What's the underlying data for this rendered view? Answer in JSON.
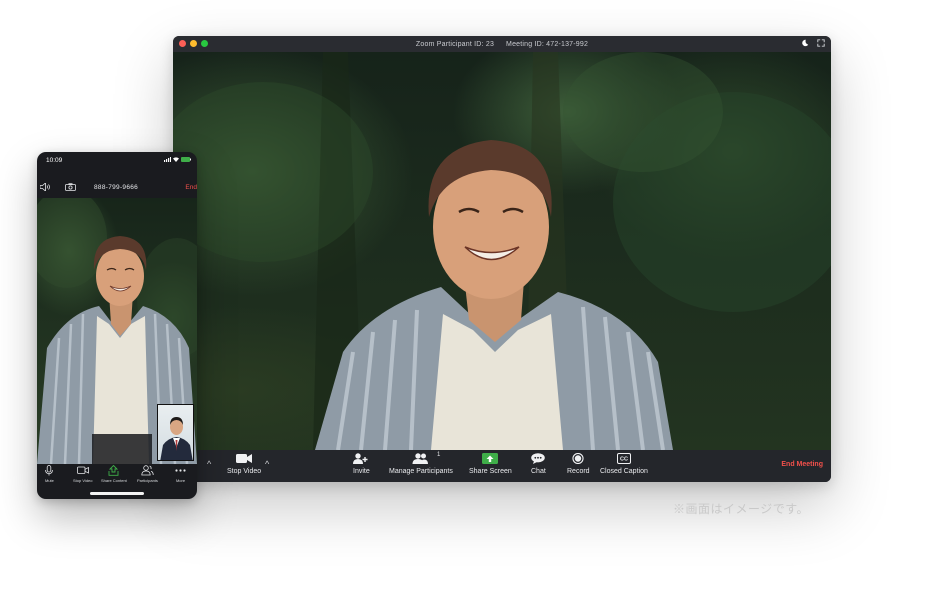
{
  "desktop": {
    "title": {
      "participant_id": "Zoom Participant ID: 23",
      "meeting_id": "Meeting ID: 472-137-992"
    },
    "toolbar": {
      "stop_video": "Stop Video",
      "invite": "Invite",
      "manage_participants": "Manage Participants",
      "participant_count": "1",
      "share_screen": "Share Screen",
      "chat": "Chat",
      "record": "Record",
      "closed_caption": "Closed Caption",
      "closed_caption_glyph": "CC",
      "end_meeting": "End Meeting"
    },
    "accent": {
      "end_meeting": "#f2504b",
      "share": "#3fae49"
    }
  },
  "phone": {
    "status_time": "10:09",
    "phone_number": "888-799-9666",
    "end_label": "End",
    "toolbar": {
      "mute": "Mute",
      "stop_video": "Stop Video",
      "share_content": "Share Content",
      "participants": "Participants",
      "more": "More"
    }
  },
  "note": "※画面はイメージです。"
}
